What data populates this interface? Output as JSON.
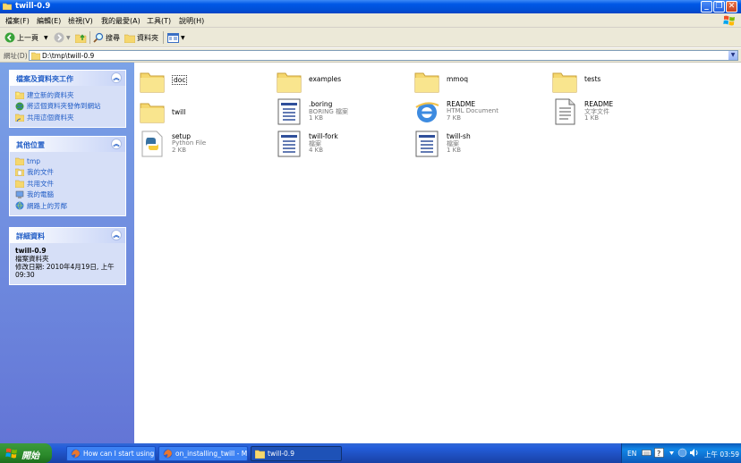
{
  "window": {
    "title": "twill-0.9",
    "title_icon": "folder-icon",
    "controls": [
      "minimize",
      "maximize",
      "close"
    ]
  },
  "menu": [
    "檔案(F)",
    "編輯(E)",
    "檢視(V)",
    "我的最愛(A)",
    "工具(T)",
    "說明(H)"
  ],
  "toolbar": {
    "back_label": "上一頁",
    "search_label": "搜尋",
    "folders_label": "資料夾"
  },
  "address": {
    "label": "網址(D)",
    "value": "D:\\tmp\\twill-0.9"
  },
  "panels": {
    "tasks": {
      "title": "檔案及資料夾工作",
      "items": [
        "建立新的資料夾",
        "將這個資料夾發佈到網站",
        "共用這個資料夾"
      ]
    },
    "places": {
      "title": "其他位置",
      "items": [
        "tmp",
        "我的文件",
        "共用文件",
        "我的電腦",
        "網路上的芳鄰"
      ]
    },
    "details": {
      "title": "詳細資料",
      "name": "twill-0.9",
      "type": "檔案資料夾",
      "modified_line1": "修改日期: 2010年4月19日, 上午",
      "modified_line2": "09:30"
    }
  },
  "files": [
    {
      "name": "doc",
      "type": "",
      "size": "",
      "icon": "folder-icon"
    },
    {
      "name": "examples",
      "type": "",
      "size": "",
      "icon": "folder-icon"
    },
    {
      "name": "mmoq",
      "type": "",
      "size": "",
      "icon": "folder-icon"
    },
    {
      "name": "tests",
      "type": "",
      "size": "",
      "icon": "folder-icon"
    },
    {
      "name": "twill",
      "type": "",
      "size": "",
      "icon": "folder-icon"
    },
    {
      "name": ".boring",
      "type": "BORING 檔案",
      "size": "1 KB",
      "icon": "generic-file-icon"
    },
    {
      "name": "README",
      "type": "HTML Document",
      "size": "7 KB",
      "icon": "ie-document-icon"
    },
    {
      "name": "README",
      "type": "文字文件",
      "size": "1 KB",
      "icon": "text-file-icon"
    },
    {
      "name": "setup",
      "type": "Python File",
      "size": "2 KB",
      "icon": "python-file-icon"
    },
    {
      "name": "twill-fork",
      "type": "檔案",
      "size": "4 KB",
      "icon": "generic-file-icon"
    },
    {
      "name": "twill-sh",
      "type": "檔案",
      "size": "1 KB",
      "icon": "generic-file-icon"
    }
  ],
  "taskbar": {
    "start_label": "開始",
    "buttons": [
      {
        "label": "How can I start using t...",
        "icon": "firefox-icon"
      },
      {
        "label": "on_installing_twill - M...",
        "icon": "firefox-icon"
      },
      {
        "label": "twill-0.9",
        "icon": "folder-icon"
      }
    ],
    "tray": {
      "lang": "EN",
      "clock": "上午 03:59"
    }
  },
  "colors": {
    "title_bar": "#0058e6",
    "task_pane": "#6b8fe0",
    "link": "#215dc6",
    "start_button": "#2b8a2b"
  }
}
